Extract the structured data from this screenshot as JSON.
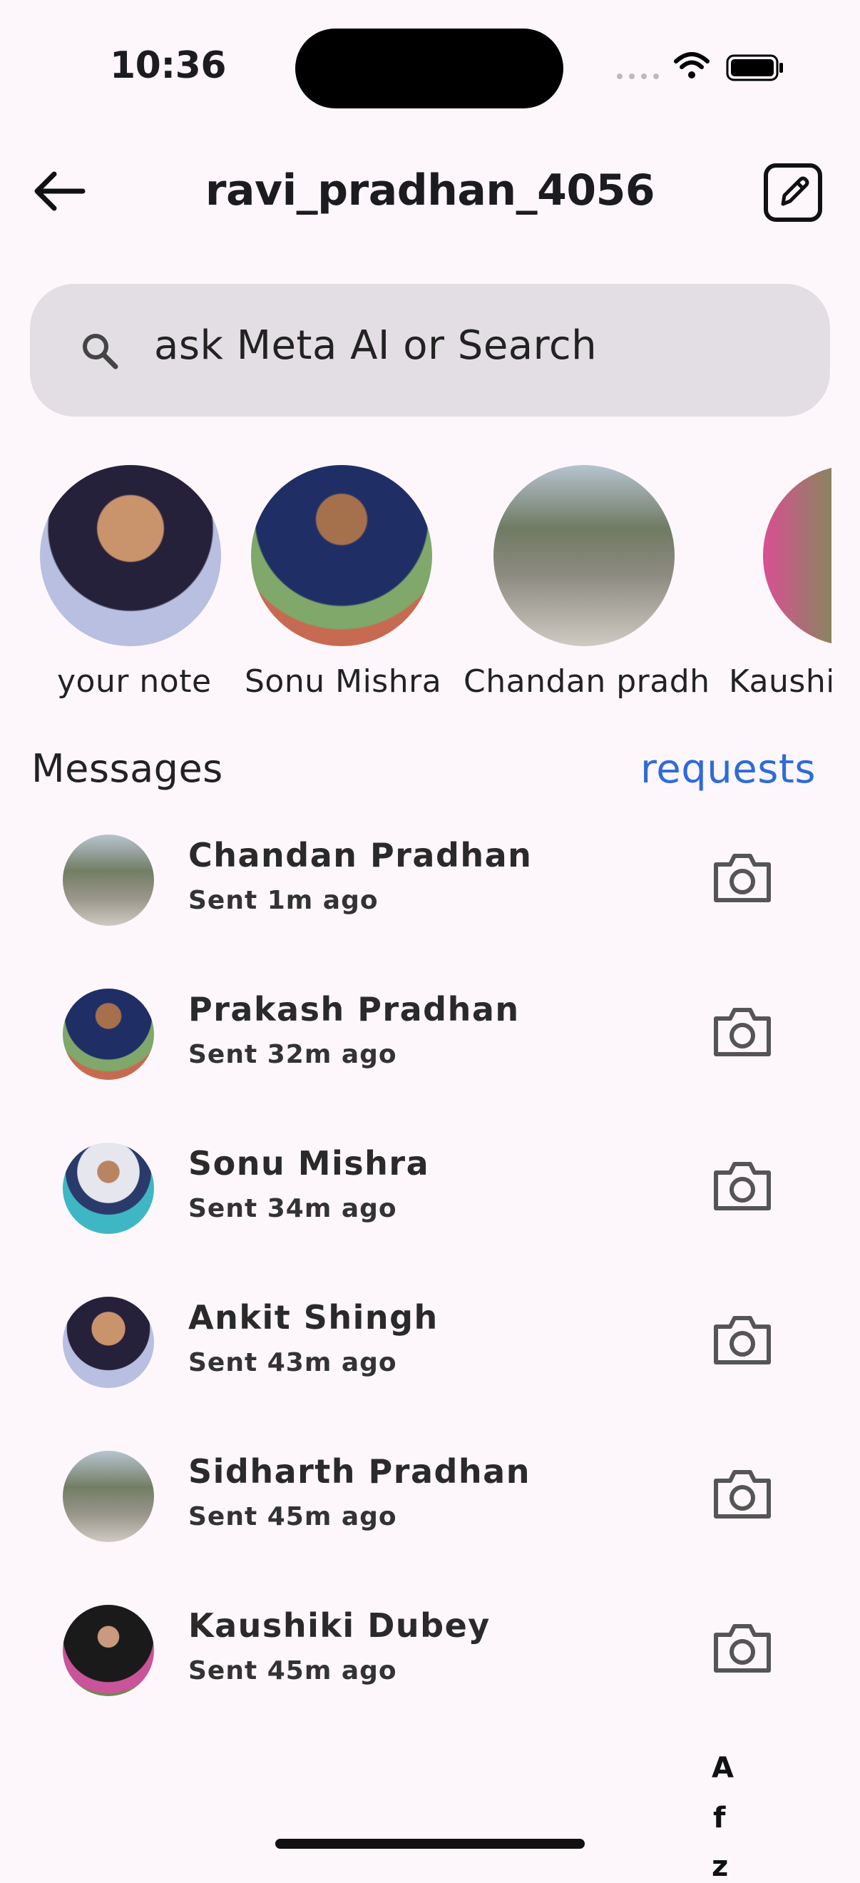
{
  "status_bar": {
    "time": "10:36"
  },
  "header": {
    "title": "ravi_pradhan_4056"
  },
  "search": {
    "placeholder": "ask Meta AI or Search"
  },
  "notes": [
    {
      "label": "your note"
    },
    {
      "label": "Sonu Mishra"
    },
    {
      "label": "Chandan pradh"
    },
    {
      "label": "Kaushi"
    }
  ],
  "messages": {
    "heading": "Messages",
    "requests_label": "requests",
    "items": [
      {
        "name": "Chandan Pradhan",
        "sub": "Sent 1m ago"
      },
      {
        "name": "Prakash Pradhan",
        "sub": "Sent 32m ago"
      },
      {
        "name": "Sonu Mishra",
        "sub": "Sent 34m ago"
      },
      {
        "name": "Ankit Shingh",
        "sub": "Sent 43m ago"
      },
      {
        "name": "Sidharth Pradhan",
        "sub": "Sent 45m ago"
      },
      {
        "name": "Kaushiki Dubey",
        "sub": "Sent 45m ago"
      }
    ]
  },
  "index_letters": [
    "A",
    "f",
    "z"
  ],
  "colors": {
    "accent": "#2f6bd8",
    "background": "#fdf7fc",
    "search_bg": "#e2dee3"
  },
  "icons": [
    "back-arrow-icon",
    "compose-icon",
    "search-icon",
    "camera-icon"
  ]
}
